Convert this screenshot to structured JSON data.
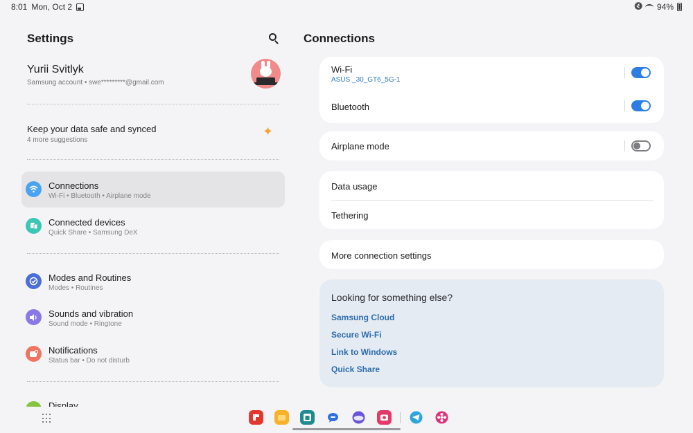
{
  "status_bar": {
    "time": "8:01",
    "date": "Mon, Oct 2",
    "battery": "94%"
  },
  "settings": {
    "title": "Settings",
    "profile": {
      "name": "Yurii Svitlyk",
      "account": "Samsung account  •  swe*********@gmail.com"
    },
    "suggestion": {
      "title": "Keep your data safe and synced",
      "subtitle": "4 more suggestions"
    },
    "items": [
      {
        "title": "Connections",
        "subtitle": "Wi-Fi  •  Bluetooth  •  Airplane mode",
        "color": "#4aa3ef"
      },
      {
        "title": "Connected devices",
        "subtitle": "Quick Share  •  Samsung DeX",
        "color": "#3cc6b4"
      },
      {
        "title": "Modes and Routines",
        "subtitle": "Modes  •  Routines",
        "color": "#4b6ed8"
      },
      {
        "title": "Sounds and vibration",
        "subtitle": "Sound mode  •  Ringtone",
        "color": "#8a78e6"
      },
      {
        "title": "Notifications",
        "subtitle": "Status bar  •  Do not disturb",
        "color": "#f07462"
      },
      {
        "title": "Display",
        "subtitle": "",
        "color": "#86c440"
      }
    ]
  },
  "connections": {
    "title": "Connections",
    "wifi": {
      "label": "Wi-Fi",
      "network": "ASUS _30_GT6_5G-1",
      "enabled": true
    },
    "bluetooth": {
      "label": "Bluetooth",
      "enabled": true
    },
    "airplane": {
      "label": "Airplane mode",
      "enabled": false
    },
    "data_usage": {
      "label": "Data usage"
    },
    "tethering": {
      "label": "Tethering"
    },
    "more": {
      "label": "More connection settings"
    },
    "looking": {
      "title": "Looking for something else?",
      "links": [
        "Samsung Cloud",
        "Secure Wi-Fi",
        "Link to Windows",
        "Quick Share"
      ]
    }
  },
  "dock": {
    "apps": [
      {
        "name": "flipboard-app",
        "color": "#e2372f"
      },
      {
        "name": "my-files-app",
        "color": "#f6b22a"
      },
      {
        "name": "calendar-app",
        "color": "#1f8a8f"
      },
      {
        "name": "messages-app",
        "color": "#2f6ee0"
      },
      {
        "name": "internet-app",
        "color": "#6a55d8"
      },
      {
        "name": "camera-app",
        "color": "#e33a6a"
      },
      {
        "name": "telegram-app",
        "color": "#2ea5db"
      },
      {
        "name": "blossom-app",
        "color": "#e2317a"
      }
    ]
  }
}
